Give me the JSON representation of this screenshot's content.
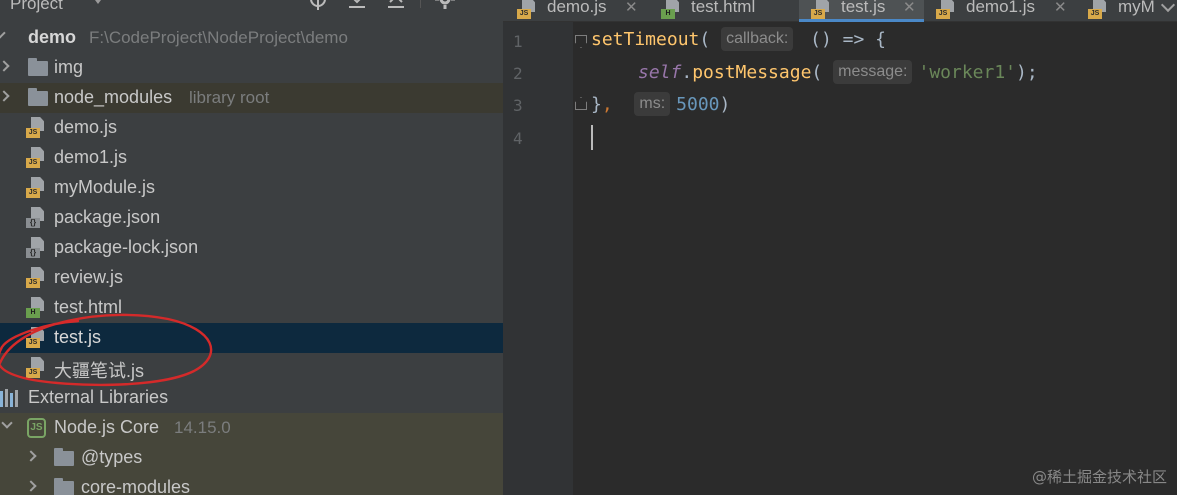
{
  "project_panel": {
    "title": "Project",
    "root": {
      "name": "demo",
      "path": "F:\\CodeProject\\NodeProject\\demo"
    },
    "items": [
      {
        "label": "img",
        "kind": "folder"
      },
      {
        "label": "node_modules",
        "kind": "folder",
        "note": "library root"
      },
      {
        "label": "demo.js",
        "kind": "js"
      },
      {
        "label": "demo1.js",
        "kind": "js"
      },
      {
        "label": "myModule.js",
        "kind": "js"
      },
      {
        "label": "package.json",
        "kind": "json"
      },
      {
        "label": "package-lock.json",
        "kind": "json"
      },
      {
        "label": "review.js",
        "kind": "js"
      },
      {
        "label": "test.html",
        "kind": "html"
      },
      {
        "label": "test.js",
        "kind": "js",
        "selected": true
      },
      {
        "label": "大疆笔试.js",
        "kind": "js"
      }
    ],
    "external_libraries": "External Libraries",
    "node_core": {
      "label": "Node.js Core",
      "version": "14.15.0"
    },
    "node_children": [
      "@types",
      "core-modules"
    ]
  },
  "tabs": [
    {
      "label": "demo.js",
      "kind": "js"
    },
    {
      "label": "test.html",
      "kind": "html"
    },
    {
      "label": "test.js",
      "kind": "js",
      "active": true
    },
    {
      "label": "demo1.js",
      "kind": "js"
    },
    {
      "label": "myM",
      "kind": "js"
    }
  ],
  "editor": {
    "line_numbers": [
      "1",
      "2",
      "3",
      "4"
    ],
    "line1": {
      "fn": "setTimeout",
      "open": "(",
      "hint": "callback:",
      "rest": " () => {"
    },
    "line2": {
      "self": "self",
      "dot": ".",
      "fn": "postMessage",
      "open": "(",
      "hint": "message:",
      "str": "'worker1'",
      "close": ");"
    },
    "line3": {
      "brace": "}",
      "comma": ",",
      "hint": "ms:",
      "num": "5000",
      "close": ")"
    }
  },
  "watermark": "@稀土掘金技术社区",
  "colors": {
    "selected_row": "#0d293e",
    "accent_tab": "#4a88c7",
    "annotation": "#d42a2a"
  }
}
